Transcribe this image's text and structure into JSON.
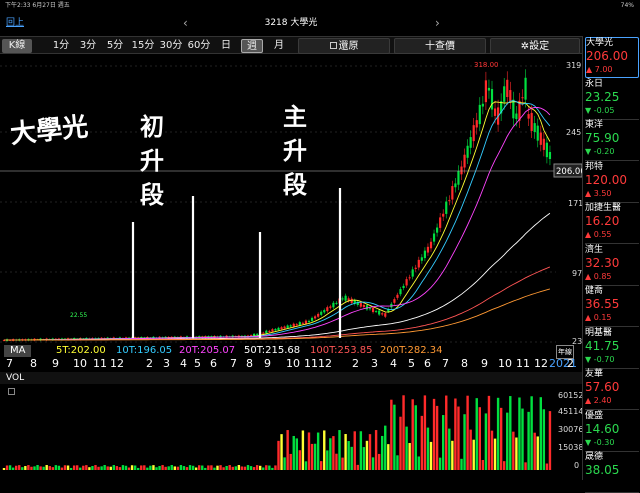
{
  "status": {
    "time_date": "下午2:33 6月27日 週五",
    "battery": "74%"
  },
  "header": {
    "back": "回上",
    "title": "3218 大學光",
    "prev": "‹",
    "next": "›"
  },
  "toolbar": {
    "kline": "K線",
    "periods": [
      "1分",
      "3分",
      "5分",
      "15分",
      "30分",
      "60分",
      "日",
      "週",
      "月"
    ],
    "restore": "還原",
    "query": "十查價",
    "settings": "✲設定"
  },
  "chart": {
    "y_ticks": [
      "319",
      "245",
      "171",
      "97",
      "23"
    ],
    "current_price": "206.00",
    "high_label": "318.00",
    "low_label": "22.55",
    "annot_main": "大學光",
    "annot_phase1": "初升段",
    "annot_phase2": "主升段"
  },
  "ma": {
    "label": "MA",
    "values": [
      {
        "t": "5T:202.00",
        "c": "#ffff33"
      },
      {
        "t": "10T:196.05",
        "c": "#33ccff"
      },
      {
        "t": "20T:205.07",
        "c": "#ff44ff"
      },
      {
        "t": "50T:215.68",
        "c": "#ffffff"
      },
      {
        "t": "100T:253.85",
        "c": "#ff5555"
      },
      {
        "t": "200T:282.34",
        "c": "#ff9933"
      }
    ],
    "annual_line": "年線"
  },
  "xaxis": {
    "labels": [
      [
        "7",
        6
      ],
      [
        "8",
        30
      ],
      [
        "9",
        52
      ],
      [
        "10",
        73
      ],
      [
        "11",
        93
      ],
      [
        "12",
        110
      ],
      [
        "2",
        146
      ],
      [
        "3",
        163
      ],
      [
        "4",
        180
      ],
      [
        "5",
        194
      ],
      [
        "6",
        210
      ],
      [
        "7",
        230
      ],
      [
        "8",
        246
      ],
      [
        "9",
        264
      ],
      [
        "10",
        286
      ],
      [
        "11",
        304
      ],
      [
        "12",
        318
      ],
      [
        "2",
        352
      ],
      [
        "3",
        371
      ],
      [
        "4",
        390
      ],
      [
        "5",
        408
      ],
      [
        "6",
        424
      ],
      [
        "7",
        442
      ],
      [
        "8",
        461
      ],
      [
        "9",
        481
      ],
      [
        "10",
        498
      ],
      [
        "11",
        516
      ],
      [
        "12",
        534
      ],
      [
        "2021",
        549
      ],
      [
        "2",
        567
      ]
    ]
  },
  "vol": {
    "label": "VOL",
    "ticks": [
      "60152",
      "45114",
      "30076",
      "15038",
      "0"
    ]
  },
  "stocks": [
    {
      "name": "大學光",
      "price": "206.00",
      "change": "7.00",
      "dir": "up"
    },
    {
      "name": "永日",
      "price": "23.25",
      "change": "-0.05",
      "dir": "dn"
    },
    {
      "name": "東洋",
      "price": "75.90",
      "change": "-0.20",
      "dir": "dn"
    },
    {
      "name": "邦特",
      "price": "120.00",
      "change": "3.50",
      "dir": "up"
    },
    {
      "name": "加捷生醫",
      "price": "16.20",
      "change": "0.55",
      "dir": "up"
    },
    {
      "name": "濟生",
      "price": "32.30",
      "change": "0.85",
      "dir": "up"
    },
    {
      "name": "健喬",
      "price": "36.55",
      "change": "0.15",
      "dir": "up"
    },
    {
      "name": "明基醫",
      "price": "41.75",
      "change": "-0.70",
      "dir": "dn"
    },
    {
      "name": "友華",
      "price": "57.60",
      "change": "2.40",
      "dir": "up"
    },
    {
      "name": "優盛",
      "price": "14.60",
      "change": "-0.30",
      "dir": "dn"
    },
    {
      "name": "晟德",
      "price": "38.05",
      "change": "",
      "dir": "dn"
    }
  ],
  "colors": {
    "up": "#ff2a2a",
    "down": "#00e040"
  }
}
